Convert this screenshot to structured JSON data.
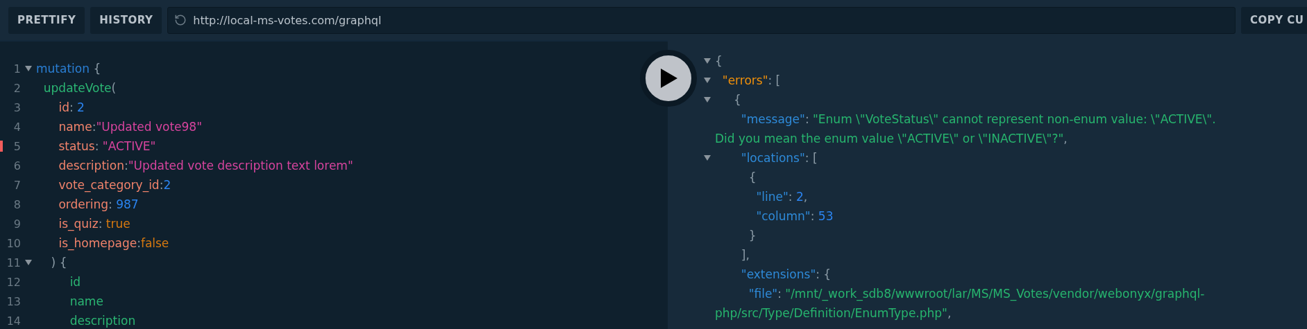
{
  "toolbar": {
    "buttons": [
      "PRETTIFY",
      "HISTORY"
    ],
    "url": "http://local-ms-votes.com/graphql",
    "copy_button": "COPY CU"
  },
  "editor": {
    "lines": [
      {
        "number": "1",
        "foldable": true,
        "error": false,
        "tokens": [
          {
            "kind": "keyword",
            "text": "mutation"
          },
          {
            "kind": "punct",
            "text": " {"
          }
        ]
      },
      {
        "number": "2",
        "foldable": false,
        "error": false,
        "tokens": [
          {
            "kind": "field",
            "text": "  updateVote"
          },
          {
            "kind": "punct",
            "text": "("
          }
        ]
      },
      {
        "number": "3",
        "foldable": false,
        "error": false,
        "tokens": [
          {
            "kind": "attr",
            "text": "      id"
          },
          {
            "kind": "punct",
            "text": ": "
          },
          {
            "kind": "number",
            "text": "2"
          }
        ]
      },
      {
        "number": "4",
        "foldable": false,
        "error": false,
        "tokens": [
          {
            "kind": "attr",
            "text": "      name"
          },
          {
            "kind": "punct",
            "text": ":"
          },
          {
            "kind": "string",
            "text": "\"Updated vote98\""
          }
        ]
      },
      {
        "number": "5",
        "foldable": false,
        "error": true,
        "tokens": [
          {
            "kind": "attr",
            "text": "      status"
          },
          {
            "kind": "punct",
            "text": ": "
          },
          {
            "kind": "string",
            "text": "\"ACTIVE\""
          }
        ]
      },
      {
        "number": "6",
        "foldable": false,
        "error": false,
        "tokens": [
          {
            "kind": "attr",
            "text": "      description"
          },
          {
            "kind": "punct",
            "text": ":"
          },
          {
            "kind": "string",
            "text": "\"Updated vote description text lorem\""
          }
        ]
      },
      {
        "number": "7",
        "foldable": false,
        "error": false,
        "tokens": [
          {
            "kind": "attr",
            "text": "      vote_category_id"
          },
          {
            "kind": "punct",
            "text": ":"
          },
          {
            "kind": "number",
            "text": "2"
          }
        ]
      },
      {
        "number": "8",
        "foldable": false,
        "error": false,
        "tokens": [
          {
            "kind": "attr",
            "text": "      ordering"
          },
          {
            "kind": "punct",
            "text": ": "
          },
          {
            "kind": "number",
            "text": "987"
          }
        ]
      },
      {
        "number": "9",
        "foldable": false,
        "error": false,
        "tokens": [
          {
            "kind": "attr",
            "text": "      is_quiz"
          },
          {
            "kind": "punct",
            "text": ": "
          },
          {
            "kind": "boolean",
            "text": "true"
          }
        ]
      },
      {
        "number": "10",
        "foldable": false,
        "error": false,
        "tokens": [
          {
            "kind": "attr",
            "text": "      is_homepage"
          },
          {
            "kind": "punct",
            "text": ":"
          },
          {
            "kind": "boolean",
            "text": "false"
          }
        ]
      },
      {
        "number": "11",
        "foldable": true,
        "error": false,
        "tokens": [
          {
            "kind": "punct",
            "text": "    ) {"
          }
        ]
      },
      {
        "number": "12",
        "foldable": false,
        "error": false,
        "tokens": [
          {
            "kind": "field",
            "text": "         id"
          }
        ]
      },
      {
        "number": "13",
        "foldable": false,
        "error": false,
        "tokens": [
          {
            "kind": "field",
            "text": "         name"
          }
        ]
      },
      {
        "number": "14",
        "foldable": false,
        "error": false,
        "tokens": [
          {
            "kind": "field",
            "text": "         description"
          }
        ]
      }
    ]
  },
  "result": {
    "lines": [
      {
        "foldable": true,
        "tokens": [
          {
            "kind": "punct",
            "text": "{"
          }
        ]
      },
      {
        "foldable": true,
        "tokens": [
          {
            "kind": "errorkey",
            "text": "  \"errors\""
          },
          {
            "kind": "punct",
            "text": ": ["
          }
        ]
      },
      {
        "foldable": true,
        "tokens": [
          {
            "kind": "punct",
            "text": "     {"
          }
        ]
      },
      {
        "foldable": false,
        "tokens": [
          {
            "kind": "key",
            "text": "       \"message\""
          },
          {
            "kind": "punct",
            "text": ": "
          },
          {
            "kind": "string",
            "text": "\"Enum \\\"VoteStatus\\\" cannot represent non-enum value: \\\"ACTIVE\\\". Did you mean the enum value \\\"ACTIVE\\\" or \\\"INACTIVE\\\"?\""
          },
          {
            "kind": "punct",
            "text": ","
          }
        ]
      },
      {
        "foldable": true,
        "tokens": [
          {
            "kind": "key",
            "text": "       \"locations\""
          },
          {
            "kind": "punct",
            "text": ": ["
          }
        ]
      },
      {
        "foldable": false,
        "tokens": [
          {
            "kind": "punct",
            "text": "         {"
          }
        ]
      },
      {
        "foldable": false,
        "tokens": [
          {
            "kind": "key",
            "text": "           \"line\""
          },
          {
            "kind": "punct",
            "text": ": "
          },
          {
            "kind": "number",
            "text": "2"
          },
          {
            "kind": "punct",
            "text": ","
          }
        ]
      },
      {
        "foldable": false,
        "tokens": [
          {
            "kind": "key",
            "text": "           \"column\""
          },
          {
            "kind": "punct",
            "text": ": "
          },
          {
            "kind": "number",
            "text": "53"
          }
        ]
      },
      {
        "foldable": false,
        "tokens": [
          {
            "kind": "punct",
            "text": "         }"
          }
        ]
      },
      {
        "foldable": false,
        "tokens": [
          {
            "kind": "punct",
            "text": "       ],"
          }
        ]
      },
      {
        "foldable": false,
        "tokens": [
          {
            "kind": "key",
            "text": "       \"extensions\""
          },
          {
            "kind": "punct",
            "text": ": {"
          }
        ]
      },
      {
        "foldable": false,
        "tokens": [
          {
            "kind": "key",
            "text": "         \"file\""
          },
          {
            "kind": "punct",
            "text": ": "
          },
          {
            "kind": "string",
            "text": "\"/mnt/_work_sdb8/wwwroot/lar/MS/MS_Votes/vendor/webonyx/graphql-php/src/Type/Definition/EnumType.php\""
          },
          {
            "kind": "punct",
            "text": ","
          }
        ]
      }
    ]
  }
}
